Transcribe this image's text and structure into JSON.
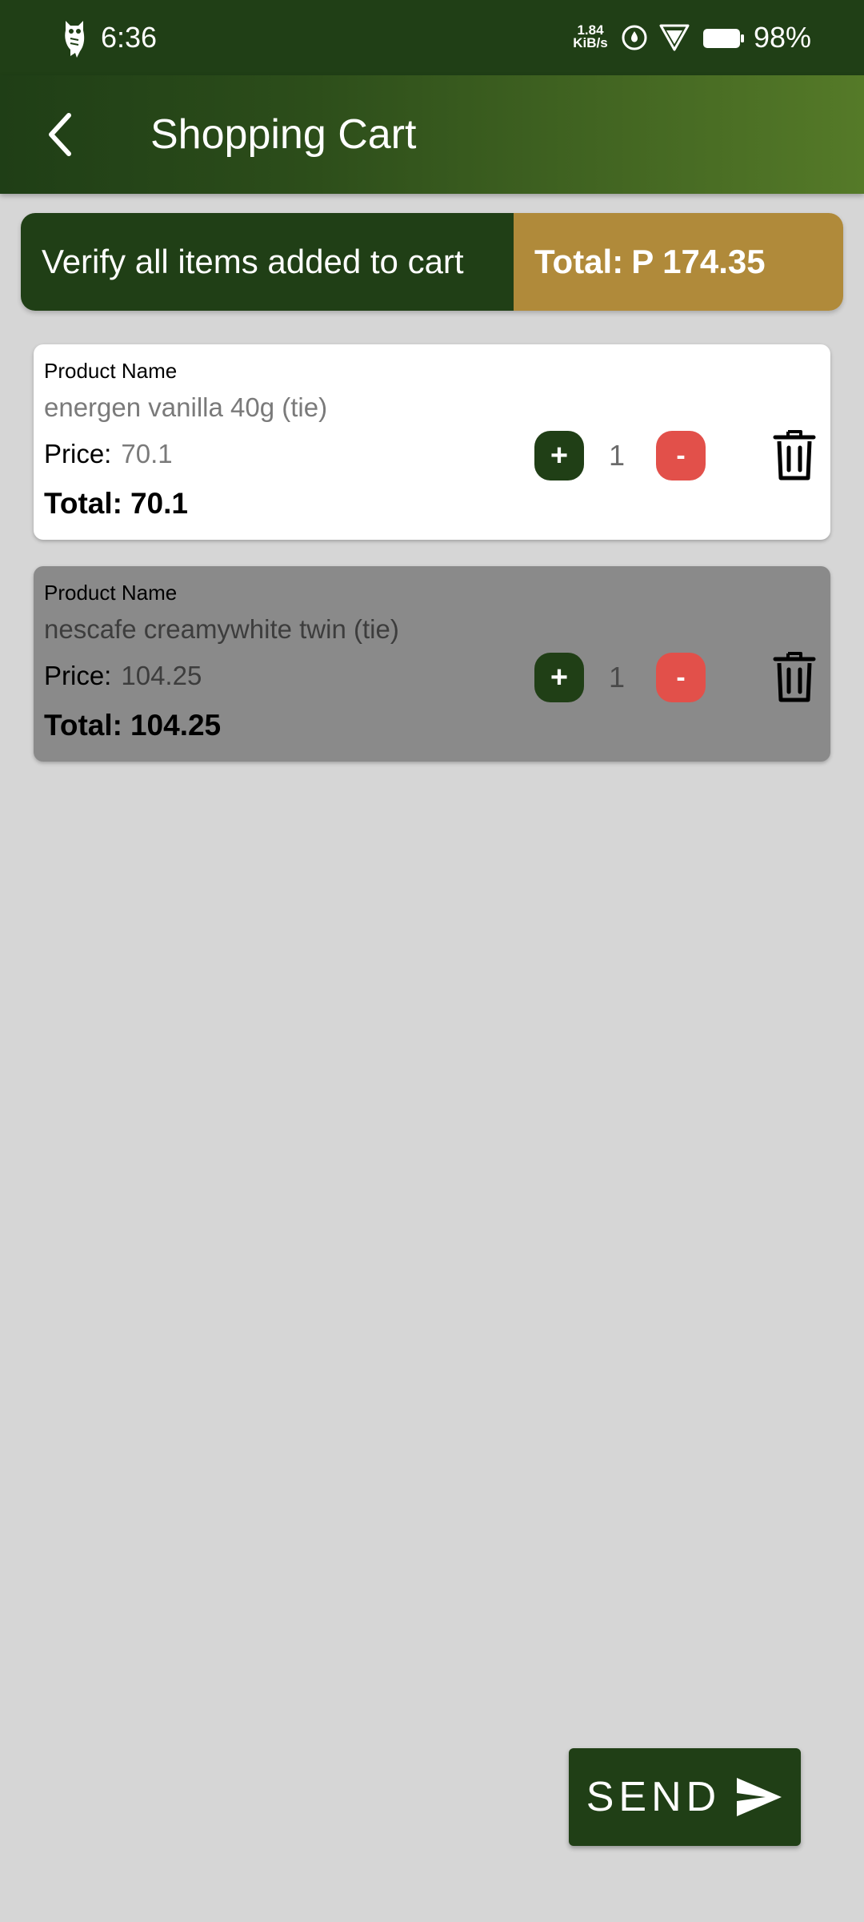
{
  "status_bar": {
    "time": "6:36",
    "net_speed_value": "1.84",
    "net_speed_unit": "KiB/s",
    "battery": "98%",
    "icons": [
      "owl-app-icon",
      "sync-icon",
      "wifi-icon",
      "battery-icon"
    ]
  },
  "app_bar": {
    "title": "Shopping Cart",
    "back_icon": "chevron-left-icon"
  },
  "summary": {
    "message": "Verify all items added to cart",
    "total_label": "Total:",
    "total_value": "P 174.35"
  },
  "cart_items": [
    {
      "name_label": "Product Name",
      "name": "energen vanilla 40g (tie)",
      "price_label": "Price:",
      "price": "70.1",
      "total_label": "Total:",
      "total": "70.1",
      "plus": "+",
      "quantity": "1",
      "minus": "-",
      "selected": false
    },
    {
      "name_label": "Product Name",
      "name": "nescafe creamywhite twin (tie)",
      "price_label": "Price:",
      "price": "104.25",
      "total_label": "Total:",
      "total": "104.25",
      "plus": "+",
      "quantity": "1",
      "minus": "-",
      "selected": true
    }
  ],
  "send_button": {
    "label": "SEND",
    "icon": "send-icon"
  },
  "colors": {
    "primary_dark_green": "#203f16",
    "app_bar_gradient_end": "#557a28",
    "gold": "#b08a3a",
    "minus_red": "#e2504a",
    "background": "#d6d6d6",
    "selected_card": "#8a8a8a"
  }
}
